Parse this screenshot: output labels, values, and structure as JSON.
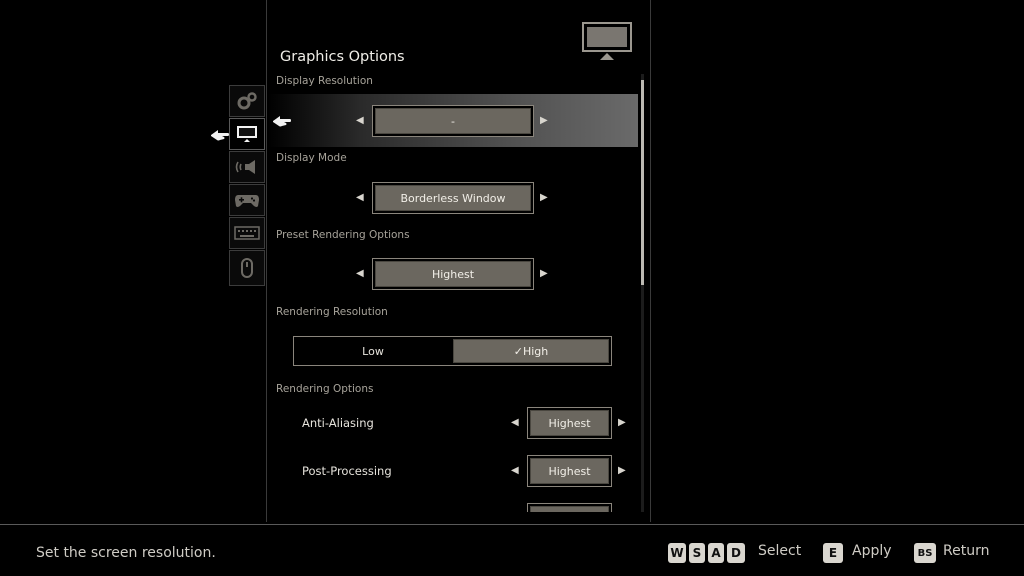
{
  "menu": {
    "title": "Graphics Options",
    "help_text": "Set the screen resolution."
  },
  "tabs": [
    {
      "icon": "gear-icon"
    },
    {
      "icon": "monitor-icon"
    },
    {
      "icon": "speaker-icon"
    },
    {
      "icon": "gamepad-icon"
    },
    {
      "icon": "keyboard-icon"
    },
    {
      "icon": "mouse-icon"
    }
  ],
  "settings": {
    "display_resolution": {
      "label": "Display Resolution",
      "value": "-"
    },
    "display_mode": {
      "label": "Display Mode",
      "value": "Borderless Window"
    },
    "preset_rendering": {
      "label": "Preset Rendering Options",
      "value": "Highest"
    },
    "rendering_resolution": {
      "label": "Rendering Resolution",
      "low": "Low",
      "high": "✓High",
      "selected": "High"
    },
    "rendering_options": {
      "label": "Rendering Options"
    },
    "anti_aliasing": {
      "label": "Anti-Aliasing",
      "value": "Highest"
    },
    "post_processing": {
      "label": "Post-Processing",
      "value": "Highest"
    }
  },
  "controls": {
    "keys_move": [
      "W",
      "S",
      "A",
      "D"
    ],
    "select_label": "Select",
    "apply_key": "E",
    "apply_label": "Apply",
    "return_key": "BS",
    "return_label": "Return"
  },
  "colors": {
    "background": "#000000",
    "value_box": "#6b675f",
    "text": "#e8e6e0"
  }
}
